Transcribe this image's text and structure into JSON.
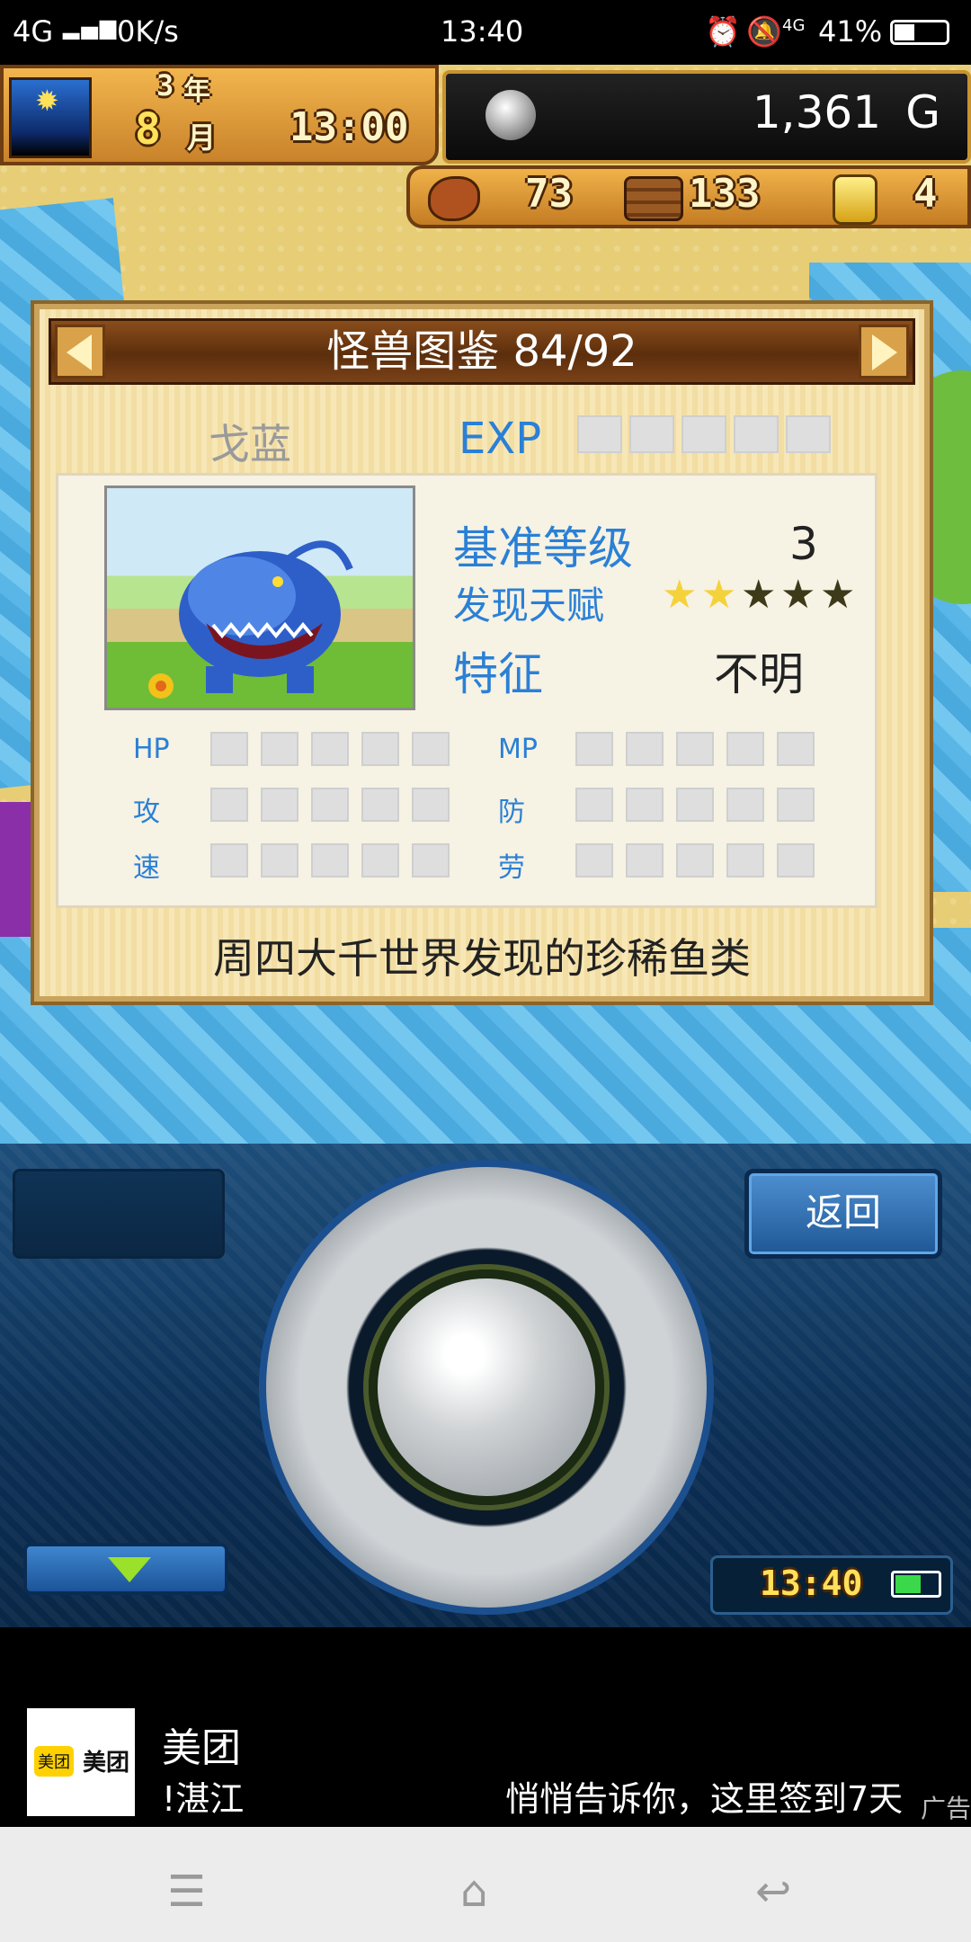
{
  "status_bar": {
    "network": "4G",
    "speed": "0K/s",
    "time": "13:40",
    "net2": "4G",
    "battery": "41%"
  },
  "hud": {
    "year": "3",
    "year_unit": "年",
    "month": "8",
    "month_unit": "月",
    "clock": "13:00",
    "money": "1,361",
    "money_unit": "G",
    "food": "73",
    "wood": "133",
    "medals": "4"
  },
  "encyclopedia": {
    "title": "怪兽图鉴 84/92",
    "monster_name": "戈蓝",
    "exp_label": "EXP",
    "base_level_label": "基准等级",
    "base_level_value": "3",
    "talent_label": "发现天赋",
    "talent_stars_filled": 2,
    "talent_stars_total": 5,
    "trait_label": "特征",
    "trait_value": "不明",
    "stats": {
      "hp": "HP",
      "mp": "MP",
      "atk": "攻",
      "def": "防",
      "spd": "速",
      "labor": "劳"
    },
    "description": "周四大千世界发现的珍稀鱼类"
  },
  "controls": {
    "back_label": "返回",
    "clock": "13:40"
  },
  "ad": {
    "logo_text": "美团",
    "brand": "美团",
    "city": "!湛江",
    "message": "悄悄告诉你，这里签到7天",
    "tag": "广告"
  },
  "colors": {
    "label_blue": "#2a80d6",
    "panel_brown": "#5c2e0c",
    "button_blue": "#1e5795",
    "star_yellow": "#f4d23a"
  }
}
